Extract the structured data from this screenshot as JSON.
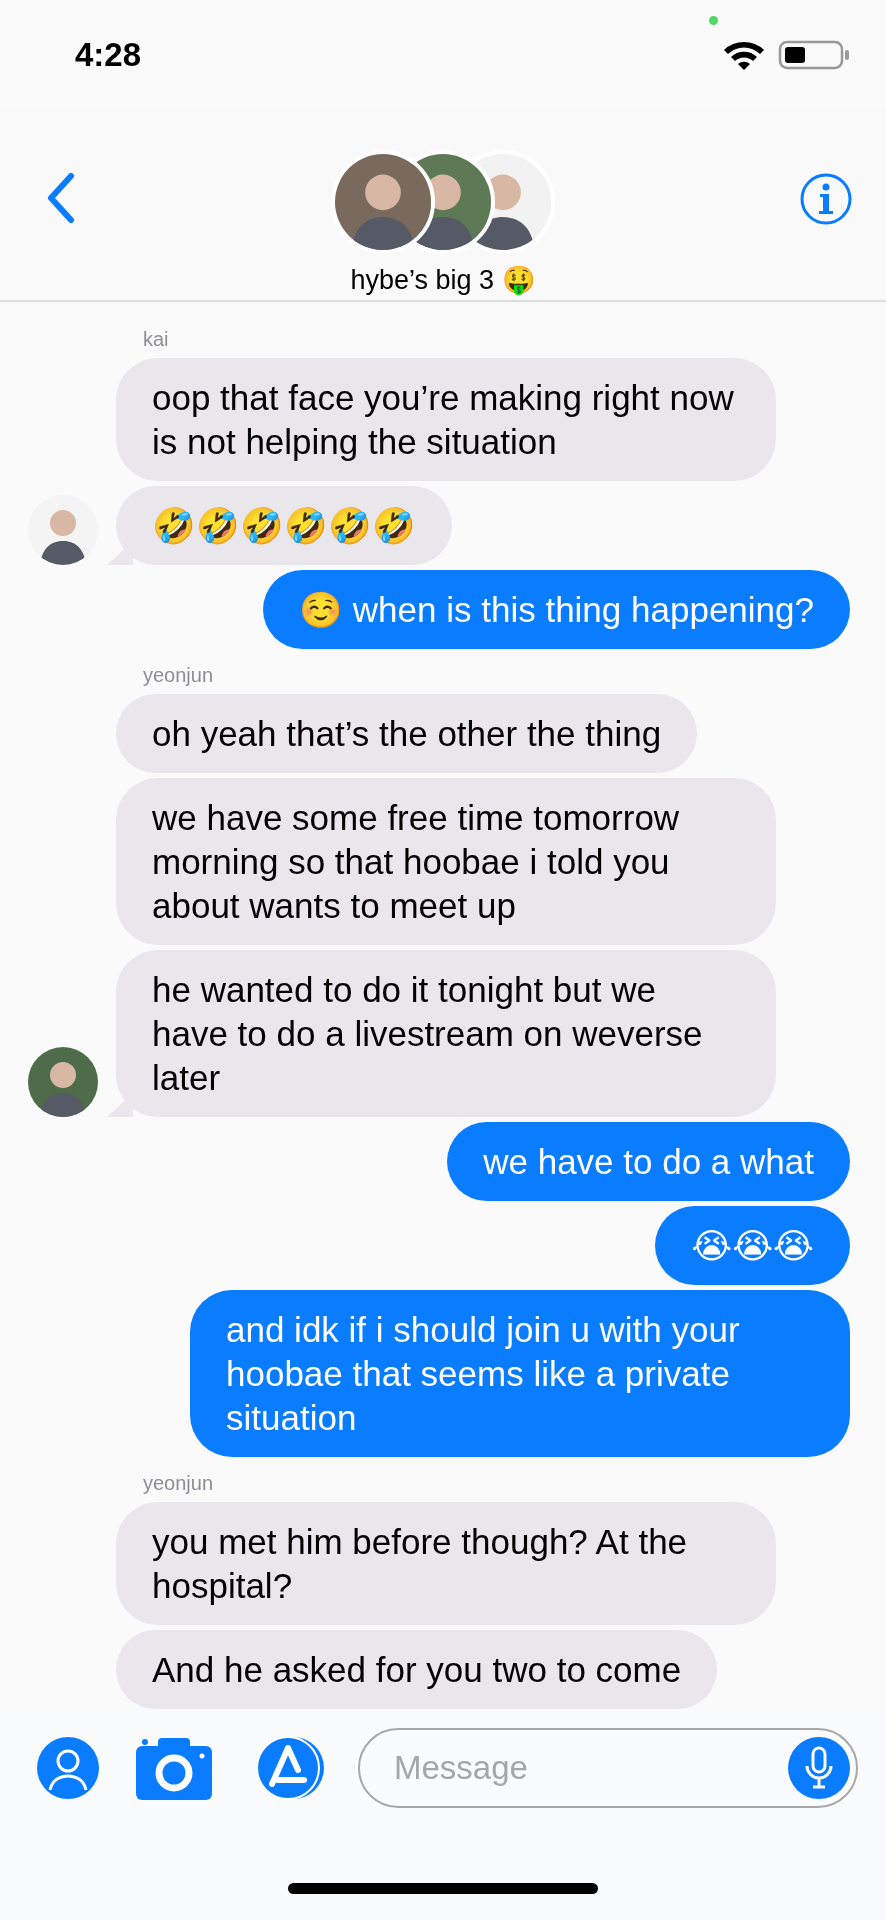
{
  "status_bar": {
    "time": "4:28"
  },
  "header": {
    "title": "hybe’s big 3 🤑"
  },
  "messages": [
    {
      "kind": "received",
      "sender": "kai",
      "text": "oop that face you’re making right now is not helping the situation",
      "avatar": false
    },
    {
      "kind": "received",
      "text": "🤣🤣🤣🤣🤣🤣",
      "avatar": true
    },
    {
      "kind": "sent",
      "text": "☺️ when is this thing happening?"
    },
    {
      "kind": "received",
      "sender": "yeonjun",
      "text": "oh yeah that’s the other the thing",
      "avatar": false
    },
    {
      "kind": "received",
      "text": "we have some free time tomorrow morning so that hoobae i told you about wants to meet up",
      "avatar": false
    },
    {
      "kind": "received",
      "text": "he wanted to do it tonight but we have to do a livestream on weverse later",
      "avatar": true
    },
    {
      "kind": "sent",
      "text": "we have to do a what"
    },
    {
      "kind": "sent",
      "text": "😭😭😭"
    },
    {
      "kind": "sent",
      "text": "and idk if i should join u with your hoobae that seems like a private situation"
    },
    {
      "kind": "received",
      "sender": "yeonjun",
      "text": "you met him before though? At the hospital?",
      "avatar": false
    },
    {
      "kind": "received",
      "text": "And he asked for you two to come",
      "avatar": false
    }
  ],
  "composer": {
    "placeholder": "Message"
  }
}
